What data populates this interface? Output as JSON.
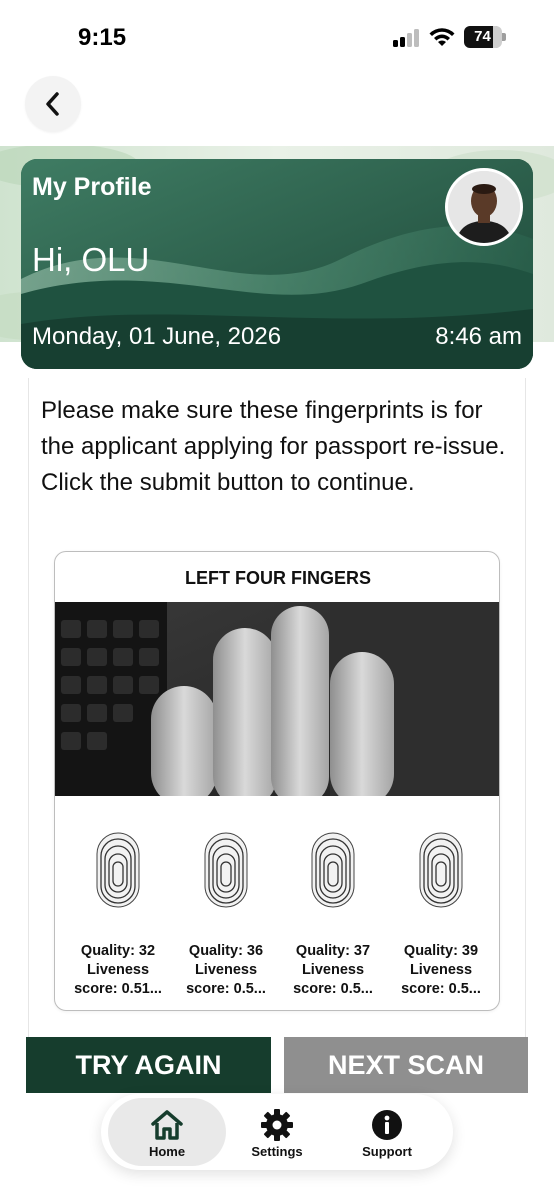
{
  "status_bar": {
    "time": "9:15",
    "battery": "74",
    "icons": [
      "signal-icon",
      "wifi-icon",
      "battery-icon"
    ]
  },
  "nav": {
    "back_icon": "chevron-left-icon"
  },
  "header": {
    "title": "My Profile",
    "greeting": "Hi, OLU",
    "date": "Monday, 01 June, 2026",
    "time": "8:46 am",
    "avatar": "user-photo"
  },
  "instructions": "Please make sure these fingerprints is for the applicant applying for passport re-issue. Click the submit button to continue.",
  "capture": {
    "title": "LEFT FOUR FINGERS",
    "fingers": [
      {
        "quality": "Quality: 32",
        "liveness_line1": "Liveness",
        "liveness_line2": "score: 0.51..."
      },
      {
        "quality": "Quality: 36",
        "liveness_line1": "Liveness",
        "liveness_line2": "score: 0.5..."
      },
      {
        "quality": "Quality: 37",
        "liveness_line1": "Liveness",
        "liveness_line2": "score: 0.5..."
      },
      {
        "quality": "Quality: 39",
        "liveness_line1": "Liveness",
        "liveness_line2": "score: 0.5..."
      }
    ]
  },
  "actions": {
    "try_again": "TRY AGAIN",
    "next_scan": "NEXT SCAN"
  },
  "bottom_nav": {
    "items": [
      {
        "label": "Home",
        "icon": "home-icon",
        "active": true
      },
      {
        "label": "Settings",
        "icon": "gear-icon",
        "active": false
      },
      {
        "label": "Support",
        "icon": "info-icon",
        "active": false
      }
    ]
  },
  "colors": {
    "primary_green": "#163d2d",
    "header_green": "#1c4a3b",
    "disabled_gray": "#8f8f8f"
  }
}
